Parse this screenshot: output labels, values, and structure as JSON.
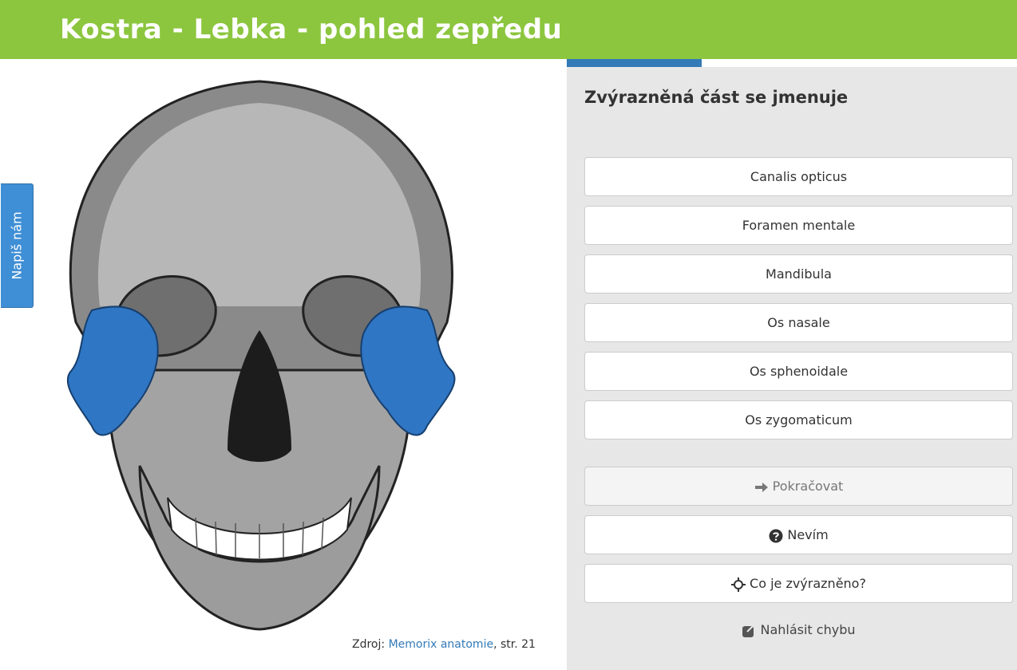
{
  "header": {
    "title": "Kostra - Lebka - pohled zepředu"
  },
  "feedback_tab": {
    "label": "Napiš nám"
  },
  "image_source": {
    "prefix": "Zdroj: ",
    "link_text": "Memorix anatomie",
    "suffix": ", str. 21"
  },
  "progress": {
    "fraction": 0.3
  },
  "quiz": {
    "question": "Zvýrazněná část se jmenuje",
    "answers": [
      "Canalis opticus",
      "Foramen mentale",
      "Mandibula",
      "Os nasale",
      "Os sphenoidale",
      "Os zygomaticum"
    ]
  },
  "actions": {
    "continue_label": "Pokračovat",
    "continue_icon": "arrow-right-icon",
    "dont_know_label": "Nevím",
    "dont_know_icon": "question-circle-icon",
    "highlighted_label": "Co je zvýrazněno?",
    "highlighted_icon": "crosshair-icon",
    "report_label": "Nahlásit chybu",
    "report_icon": "external-link-icon"
  },
  "colors": {
    "header": "#8cc63f",
    "highlight": "#2f76c4",
    "progress": "#337ab7"
  }
}
